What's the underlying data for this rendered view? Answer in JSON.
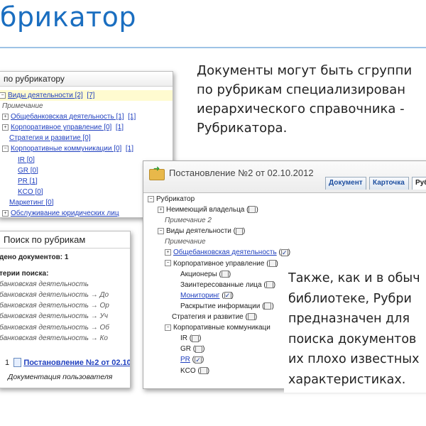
{
  "slide": {
    "title": "брикатор",
    "intro_lines": [
      "Документы могут быть сгруппи",
      "по рубрикам специализирован",
      "иерархического справочника -",
      "Рубрикатора."
    ],
    "note_lines": [
      "Также, как и в обыч",
      "библиотеке, Рубри",
      "предназначен для",
      "поиска документов",
      "их плохо известных",
      "характеристиках."
    ]
  },
  "rubricator_panel": {
    "header": "по рубрикатору",
    "rows": [
      {
        "text": "Виды деятельности [2]",
        "extra": "[7]"
      },
      {
        "text": "Примечание"
      },
      {
        "text": "Общебанковская деятельность [1]",
        "extra": "[1]"
      },
      {
        "text": "Корпоративное управление [0]",
        "extra": "[1]"
      },
      {
        "text": "Стратегия и развитие [0]"
      },
      {
        "text": "Корпоративные коммуникации [0]",
        "extra": "[1]"
      },
      {
        "text": "IR [0]"
      },
      {
        "text": "GR [0]"
      },
      {
        "text": "PR [1]"
      },
      {
        "text": "KCO [0]"
      },
      {
        "text": "Маркетинг [0]"
      },
      {
        "text": "Обслуживание юридических лиц"
      }
    ]
  },
  "search_panel": {
    "header": "Поиск по рубрикам",
    "found": "дено документов: 1",
    "criteria_label": "терии поиска:",
    "criteria": [
      "банковская деятельность",
      "банковская деятельность → До",
      "банковская деятельность → Ор",
      "банковская деятельность → Уч",
      "банковская деятельность → Об",
      "банковская деятельность → Ко"
    ],
    "result_index": "1",
    "result_link": "Постановление №2 от 02.10",
    "result_desc": "Документация пользователя"
  },
  "doc_window": {
    "title": "Постановление №2 от 02.10.2012",
    "tabs": [
      "Документ",
      "Карточка",
      "Руб"
    ],
    "rows": [
      {
        "text": "Рубрикатор"
      },
      {
        "text": "Неимеющий владельца ("
      },
      {
        "text": "Примечание 2"
      },
      {
        "text": "Виды деятельности ("
      },
      {
        "text": "Примечание"
      },
      {
        "text": "Общебанковская деятельность"
      },
      {
        "text": "Корпоративное управление ("
      },
      {
        "text": "Акционеры ("
      },
      {
        "text": "Заинтересованные лица ("
      },
      {
        "text": "Мониторинг"
      },
      {
        "text": "Раскрытие информации ("
      },
      {
        "text": "Стратегия и развитие ("
      },
      {
        "text": "Корпоративные коммуникаци"
      },
      {
        "text": "IR ("
      },
      {
        "text": "GR ("
      },
      {
        "text": "PR"
      },
      {
        "text": "KCO ("
      }
    ],
    "close_paren": ")",
    "check_mark": "✓"
  }
}
